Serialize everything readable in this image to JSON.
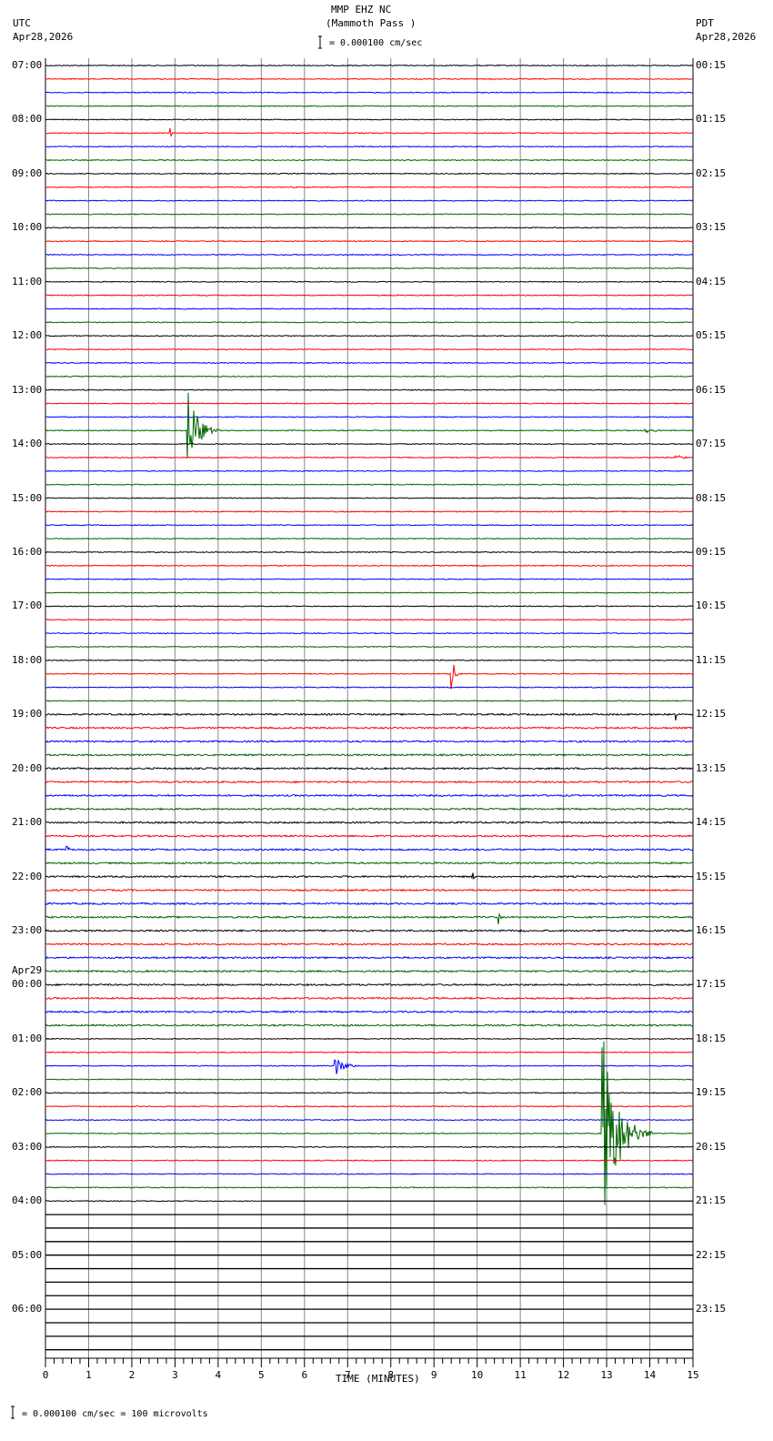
{
  "header": {
    "station": "MMP EHZ NC",
    "location": "(Mammoth Pass )",
    "left_tz": "UTC",
    "left_date": "Apr28,2026",
    "right_tz": "PDT",
    "right_date": "Apr28,2026",
    "scale": "= 0.000100 cm/sec"
  },
  "footer": {
    "scale": "= 0.000100 cm/sec =     100 microvolts"
  },
  "chart_data": {
    "type": "line",
    "title": "MMP EHZ NC (Mammoth Pass )",
    "xlabel": "TIME (MINUTES)",
    "xlim": [
      0,
      15
    ],
    "x_ticks": [
      "0",
      "1",
      "2",
      "3",
      "4",
      "5",
      "6",
      "7",
      "8",
      "9",
      "10",
      "11",
      "12",
      "13",
      "14",
      "15"
    ],
    "rows_per_hour": 4,
    "total_rows": 96,
    "trace_colors": [
      "#000000",
      "#ff0000",
      "#0000ff",
      "#006400"
    ],
    "left_labels": [
      "07:00",
      "08:00",
      "09:00",
      "10:00",
      "11:00",
      "12:00",
      "13:00",
      "14:00",
      "15:00",
      "16:00",
      "17:00",
      "18:00",
      "19:00",
      "20:00",
      "21:00",
      "22:00",
      "23:00",
      "00:00",
      "01:00",
      "02:00",
      "03:00",
      "04:00",
      "05:00",
      "06:00"
    ],
    "date_change_label": "Apr29",
    "right_labels": [
      "00:15",
      "01:15",
      "02:15",
      "03:15",
      "04:15",
      "05:15",
      "06:15",
      "07:15",
      "08:15",
      "09:15",
      "10:15",
      "11:15",
      "12:15",
      "13:15",
      "14:15",
      "15:15",
      "16:15",
      "17:15",
      "18:15",
      "19:15",
      "20:15",
      "21:15",
      "22:15",
      "23:15"
    ],
    "data_end": {
      "row": 84,
      "minute": 5
    },
    "events": [
      {
        "row": 5,
        "minute": 2.9,
        "amplitude": 5,
        "duration": 0.1
      },
      {
        "row": 27,
        "minute": 13.9,
        "amplitude": 3,
        "duration": 0.6
      },
      {
        "row": 27,
        "minute": 3.3,
        "amplitude": 50,
        "duration": 0.8
      },
      {
        "row": 29,
        "minute": 14.6,
        "amplitude": 5,
        "duration": 0.4
      },
      {
        "row": 45,
        "minute": 9.4,
        "amplitude": 22,
        "duration": 0.3
      },
      {
        "row": 48,
        "minute": 14.6,
        "amplitude": 14,
        "duration": 0.1
      },
      {
        "row": 58,
        "minute": 0.5,
        "amplitude": 12,
        "duration": 0.1
      },
      {
        "row": 60,
        "minute": 9.9,
        "amplitude": 6,
        "duration": 0.1
      },
      {
        "row": 63,
        "minute": 10.5,
        "amplitude": 8,
        "duration": 0.1
      },
      {
        "row": 64,
        "minute": 11.0,
        "amplitude": 6,
        "duration": 0.3
      },
      {
        "row": 74,
        "minute": 6.7,
        "amplitude": 14,
        "duration": 0.7
      },
      {
        "row": 79,
        "minute": 12.9,
        "amplitude": 120,
        "duration": 1.2
      }
    ],
    "noisy_rows_range": [
      48,
      72
    ]
  }
}
